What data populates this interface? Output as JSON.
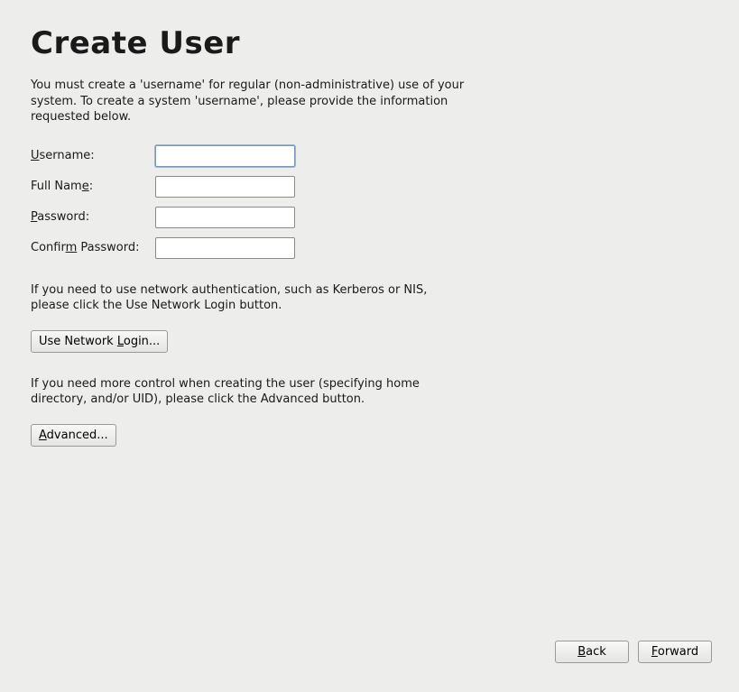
{
  "heading": "Create User",
  "intro": "You must create a 'username' for regular (non-administrative) use of your system.  To create a system 'username', please provide the information requested below.",
  "form": {
    "username": {
      "accel": "U",
      "rest": "sername:",
      "value": ""
    },
    "fullname": {
      "pre": "Full Nam",
      "accel": "e",
      "rest": ":",
      "value": ""
    },
    "password": {
      "accel": "P",
      "rest": "assword:",
      "value": ""
    },
    "confirm": {
      "pre": "Confir",
      "accel": "m",
      "rest": " Password:",
      "value": ""
    }
  },
  "network_text": "If you need to use network authentication, such as Kerberos or NIS, please click the Use Network Login button.",
  "network_button": {
    "pre": "Use Network ",
    "accel": "L",
    "rest": "ogin..."
  },
  "advanced_text": "If you need more control when creating the user (specifying home directory, and/or UID), please click the Advanced button.",
  "advanced_button": {
    "accel": "A",
    "rest": "dvanced..."
  },
  "nav": {
    "back": {
      "accel": "B",
      "rest": "ack"
    },
    "forward": {
      "accel": "F",
      "rest": "orward"
    }
  }
}
